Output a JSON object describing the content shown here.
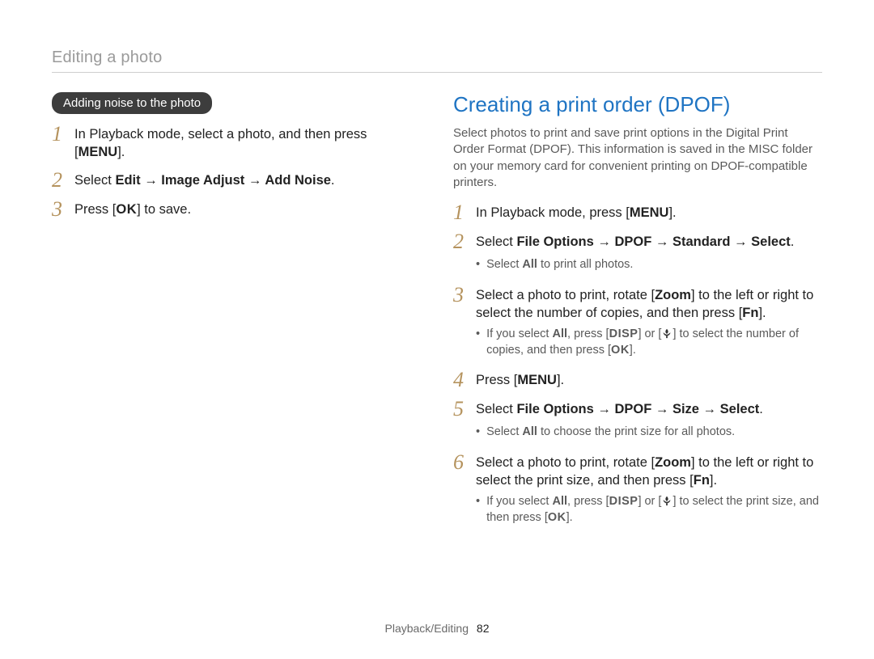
{
  "header": "Editing a photo",
  "left": {
    "pill": "Adding noise to the photo",
    "steps": [
      {
        "num": "1",
        "pre": "In Playback mode, select a photo, and then press [",
        "key": "MENU",
        "post": "]."
      },
      {
        "num": "2",
        "pre": "Select ",
        "bold": "Edit → Image Adjust → Add Noise",
        "post": "."
      },
      {
        "num": "3",
        "pre": "Press [",
        "key": "OK",
        "post": "] to save."
      }
    ]
  },
  "right": {
    "heading": "Creating a print order (DPOF)",
    "intro": "Select photos to print and save print options in the Digital Print Order Format (DPOF). This information is saved in the MISC folder on your memory card for convenient printing on DPOF-compatible printers.",
    "steps": [
      {
        "num": "1",
        "pre": "In Playback mode, press [",
        "key": "MENU",
        "post": "]."
      },
      {
        "num": "2",
        "pre": "Select ",
        "bold": "File Options → DPOF → Standard → Select",
        "post": ".",
        "sub": [
          {
            "pre": "Select ",
            "bold": "All",
            "post": " to print all photos."
          }
        ]
      },
      {
        "num": "3",
        "pre1": "Select a photo to print, rotate [",
        "bold1": "Zoom",
        "mid": "] to the left or right to select the number of copies, and then press [",
        "key": "Fn",
        "post": "].",
        "sub": [
          {
            "pre": "If you select ",
            "bold": "All",
            "mid1": ", press [",
            "key1": "DISP",
            "mid2": "] or [",
            "icon": "macro",
            "mid3": "] to select the number of copies, and then press [",
            "key2": "OK",
            "post": "]."
          }
        ]
      },
      {
        "num": "4",
        "pre": "Press [",
        "key": "MENU",
        "post": "]."
      },
      {
        "num": "5",
        "pre": "Select ",
        "bold": "File Options → DPOF → Size → Select",
        "post": ".",
        "sub": [
          {
            "pre": "Select ",
            "bold": "All",
            "post": " to choose the print size for all photos."
          }
        ]
      },
      {
        "num": "6",
        "pre1": "Select a photo to print, rotate [",
        "bold1": "Zoom",
        "mid": "] to the left or right to select the print size, and then press [",
        "key": "Fn",
        "post": "].",
        "sub": [
          {
            "pre": "If you select ",
            "bold": "All",
            "mid1": ", press [",
            "key1": "DISP",
            "mid2": "] or [",
            "icon": "macro",
            "mid3": "] to select the print size, and then press [",
            "key2": "OK",
            "post": "]."
          }
        ]
      }
    ]
  },
  "footer": {
    "section": "Playback/Editing",
    "page": "82"
  }
}
